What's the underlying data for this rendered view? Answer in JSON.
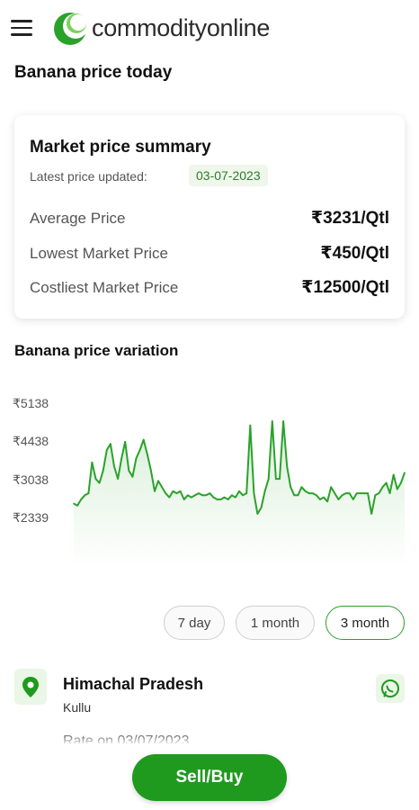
{
  "header": {
    "logo_text": "commodityonline",
    "brand_color": "#2aa22a",
    "icons": [
      "menu-icon",
      "logo-icon"
    ]
  },
  "page_title": "Banana price today",
  "summary": {
    "title": "Market price summary",
    "updated_label": "Latest price updated:",
    "updated_date": "03-07-2023",
    "rows": [
      {
        "label": "Average Price",
        "value": "₹3231/Qtl"
      },
      {
        "label": "Lowest Market Price",
        "value": "₹450/Qtl"
      },
      {
        "label": "Costliest Market Price",
        "value": "₹12500/Qtl"
      }
    ]
  },
  "variation_title": "Banana price variation",
  "chart_data": {
    "type": "area",
    "yticks": [
      "₹5138",
      "₹4438",
      "₹3038",
      "₹2339"
    ],
    "ytick_values": [
      5138,
      4438,
      3038,
      2339
    ],
    "ylim": [
      2339,
      5138
    ],
    "line_color": "#2aa22a",
    "grid": false,
    "values": [
      2700,
      2650,
      2800,
      2900,
      2950,
      3700,
      3300,
      3200,
      3500,
      4000,
      4150,
      3600,
      3300,
      3800,
      4200,
      3500,
      3350,
      3800,
      4000,
      4250,
      3900,
      3500,
      3000,
      3250,
      3100,
      2950,
      2850,
      3000,
      2950,
      3000,
      2800,
      2900,
      2850,
      2900,
      2950,
      2900,
      2900,
      2950,
      2850,
      2800,
      2800,
      2850,
      2800,
      2900,
      2850,
      3000,
      2900,
      2950,
      4600,
      2950,
      2450,
      2600,
      3000,
      3300,
      4700,
      3300,
      3300,
      4700,
      3600,
      3100,
      2900,
      2900,
      3100,
      3000,
      2950,
      2950,
      2900,
      2800,
      2850,
      2750,
      3100,
      2950,
      2800,
      2900,
      2950,
      2950,
      2800,
      2950,
      2950,
      2950,
      2950,
      2450,
      2900,
      2950,
      3100,
      3200,
      2950,
      3400,
      3050,
      3200,
      3450
    ]
  },
  "ranges": [
    "7 day",
    "1 month",
    "3 month"
  ],
  "active_range": "3 month",
  "location": {
    "state": "Himachal Pradesh",
    "district": "Kullu",
    "rate_label": "Rate on 03/07/2023",
    "icons": [
      "location-pin-icon",
      "whatsapp-icon"
    ]
  },
  "cta": {
    "label": "Sell/Buy"
  }
}
